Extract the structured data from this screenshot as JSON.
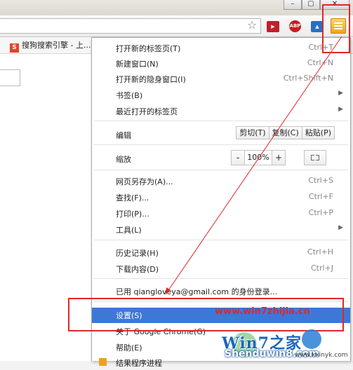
{
  "window": {
    "min_icon": "minimize-icon",
    "max_icon": "restore-icon",
    "close_icon": "close-icon"
  },
  "toolbar": {
    "star_icon": "bookmark-star-icon",
    "extensions": [
      "video-extension-icon",
      "adblock-plus-icon",
      "blue-extension-icon"
    ],
    "abp_label": "ABP",
    "menu_icon": "hamburger-menu-icon"
  },
  "bookmarks": {
    "item_label": "搜狗搜索引擎 - 上...",
    "item_icon_letter": "S"
  },
  "menu": {
    "new_tab": {
      "label": "打开新的标签页(T)",
      "shortcut": "Ctrl+T"
    },
    "new_window": {
      "label": "新建窗口(N)",
      "shortcut": "Ctrl+N"
    },
    "incognito": {
      "label": "打开新的隐身窗口(I)",
      "shortcut": "Ctrl+Shift+N"
    },
    "bookmarks": {
      "label": "书签(B)"
    },
    "recent_tabs": {
      "label": "最近打开的标签页"
    },
    "edit": {
      "label": "编辑",
      "cut": "剪切(T)",
      "copy": "复制(C)",
      "paste": "粘贴(P)"
    },
    "zoom": {
      "label": "缩放",
      "minus": "-",
      "value": "100%",
      "plus": "+"
    },
    "save_as": {
      "label": "网页另存为(A)...",
      "shortcut": "Ctrl+S"
    },
    "find": {
      "label": "查找(F)...",
      "shortcut": "Ctrl+F"
    },
    "print": {
      "label": "打印(P)...",
      "shortcut": "Ctrl+P"
    },
    "tools": {
      "label": "工具(L)"
    },
    "history": {
      "label": "历史记录(H)",
      "shortcut": "Ctrl+H"
    },
    "downloads": {
      "label": "下载内容(D)",
      "shortcut": "Ctrl+J"
    },
    "signed_in": {
      "label": "已用 qiangloveya@gmail.com 的身份登录..."
    },
    "settings": {
      "label": "设置(S)"
    },
    "about": {
      "label": "关于 Google Chrome(G)"
    },
    "help": {
      "label": "帮助(E)"
    },
    "last_partial": {
      "label": "结果程序进程"
    }
  },
  "watermark": {
    "url": "www.win7zhijia.cn",
    "logo": "Win7之家",
    "domain": "Shenduwin8.com",
    "site": "www.kxinyk.com"
  },
  "colors": {
    "highlight": "#3e78d6",
    "annotation": "#e0262a",
    "menu_button": "#f2a21f"
  }
}
